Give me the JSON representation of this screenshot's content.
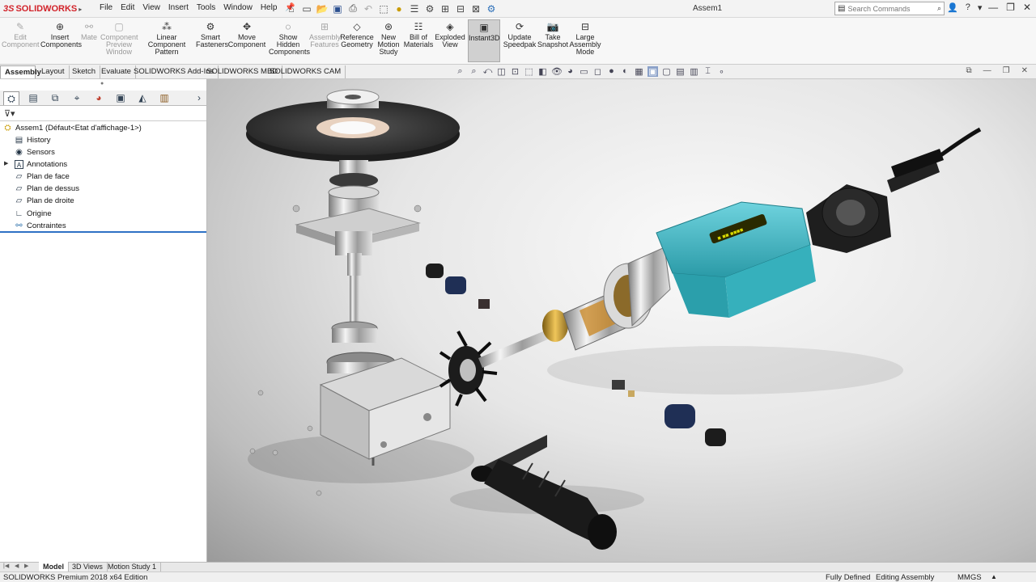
{
  "app": {
    "logo_ds": "3S",
    "logo_text": "SOLIDWORKS",
    "doc_title": "Assem1"
  },
  "menu": [
    "File",
    "Edit",
    "View",
    "Insert",
    "Tools",
    "Window",
    "Help"
  ],
  "search": {
    "placeholder": "Search Commands"
  },
  "commands": [
    {
      "label": "Edit\nComponent",
      "icon": "edit-component-icon",
      "enabled": false
    },
    {
      "label": "Insert\nComponents",
      "icon": "insert-components-icon",
      "enabled": true
    },
    {
      "label": "Mate",
      "icon": "mate-icon",
      "enabled": false
    },
    {
      "label": "Component\nPreview\nWindow",
      "icon": "component-preview-icon",
      "enabled": false
    },
    {
      "label": "Linear Component\nPattern",
      "icon": "linear-pattern-icon",
      "enabled": true
    },
    {
      "label": "Smart\nFasteners",
      "icon": "smart-fasteners-icon",
      "enabled": true
    },
    {
      "label": "Move\nComponent",
      "icon": "move-component-icon",
      "enabled": true
    },
    {
      "label": "Show\nHidden\nComponents",
      "icon": "show-hidden-icon",
      "enabled": true
    },
    {
      "label": "Assembly\nFeatures",
      "icon": "assembly-features-icon",
      "enabled": false
    },
    {
      "label": "Reference\nGeometry",
      "icon": "reference-geometry-icon",
      "enabled": true
    },
    {
      "label": "New\nMotion\nStudy",
      "icon": "motion-study-icon",
      "enabled": true
    },
    {
      "label": "Bill of\nMaterials",
      "icon": "bom-icon",
      "enabled": true
    },
    {
      "label": "Exploded\nView",
      "icon": "exploded-view-icon",
      "enabled": true
    },
    {
      "label": "Instant3D",
      "icon": "instant3d-icon",
      "enabled": true,
      "active": true
    },
    {
      "label": "Update\nSpeedpak",
      "icon": "speedpak-icon",
      "enabled": true
    },
    {
      "label": "Take\nSnapshot",
      "icon": "camera-icon",
      "enabled": true
    },
    {
      "label": "Large\nAssembly\nMode",
      "icon": "large-assembly-icon",
      "enabled": true
    }
  ],
  "cm_tabs": [
    "Assembly",
    "Layout",
    "Sketch",
    "Evaluate",
    "SOLIDWORKS Add-Ins",
    "SOLIDWORKS MBD",
    "SOLIDWORKS CAM"
  ],
  "tree": {
    "root": "Assem1  (Défaut<Etat d'affichage-1>)",
    "items": [
      {
        "label": "History",
        "icon": "history-icon"
      },
      {
        "label": "Sensors",
        "icon": "sensors-icon"
      },
      {
        "label": "Annotations",
        "icon": "annotations-icon",
        "expandable": true
      },
      {
        "label": "Plan de face",
        "icon": "plane-icon"
      },
      {
        "label": "Plan de dessus",
        "icon": "plane-icon"
      },
      {
        "label": "Plan de droite",
        "icon": "plane-icon"
      },
      {
        "label": "Origine",
        "icon": "origin-icon"
      },
      {
        "label": "Contraintes",
        "icon": "mates-icon"
      }
    ]
  },
  "bottom_tabs": [
    "Model",
    "3D Views",
    "Motion Study 1"
  ],
  "status": {
    "edition": "SOLIDWORKS Premium 2018 x64 Edition",
    "defined": "Fully Defined",
    "mode": "Editing Assembly",
    "units": "MMGS"
  },
  "colors": {
    "brand_red": "#d2232a",
    "grinder_teal": "#3fb7c4",
    "rollback_blue": "#2e71c5"
  }
}
